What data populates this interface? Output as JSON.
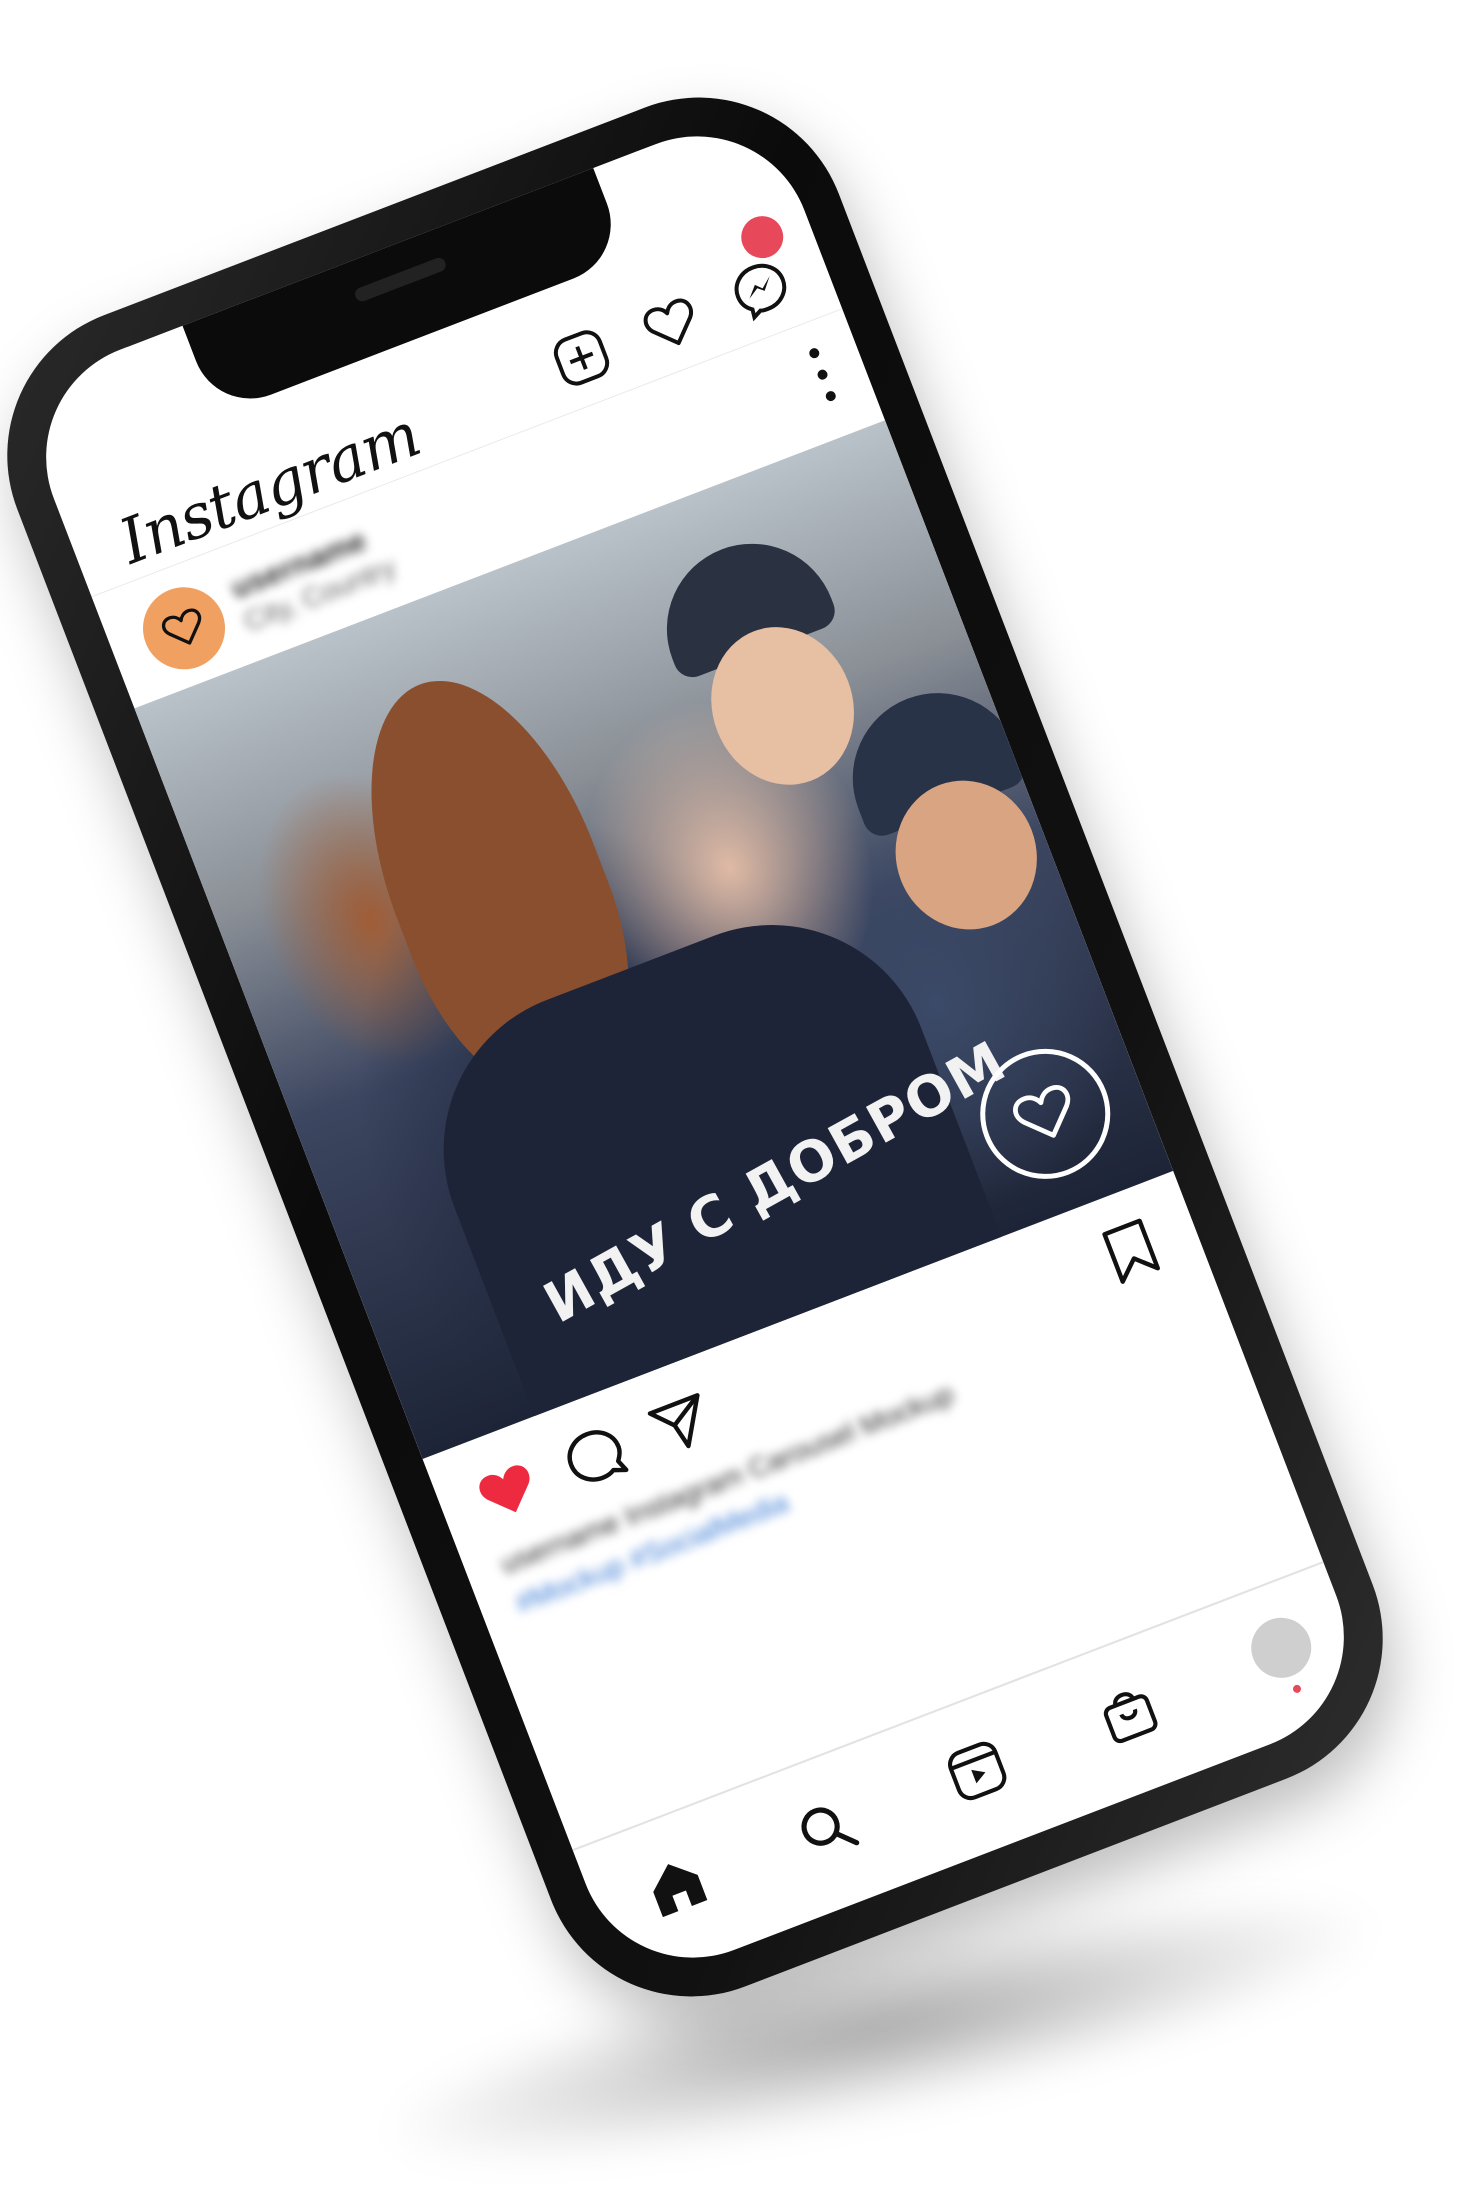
{
  "app": {
    "logo_text": "Instagram"
  },
  "top_nav": {
    "icons": [
      "new-post-icon",
      "heart-icon",
      "messenger-icon"
    ],
    "badge_color": "#e8495a"
  },
  "post": {
    "username": "username",
    "location": "City, Country",
    "avatar_color": "#f0a060",
    "photo_caption_text": "ИДУ С ДОБРОМ",
    "liked": true,
    "like_color": "#ed2a3f",
    "caption_line1": "username Instagram Carousel Mockup",
    "caption_tags": "#Mockup #SocialMedia"
  },
  "bottom_nav": {
    "items": [
      "home-icon",
      "search-icon",
      "reels-icon",
      "shop-icon",
      "profile-avatar"
    ]
  }
}
